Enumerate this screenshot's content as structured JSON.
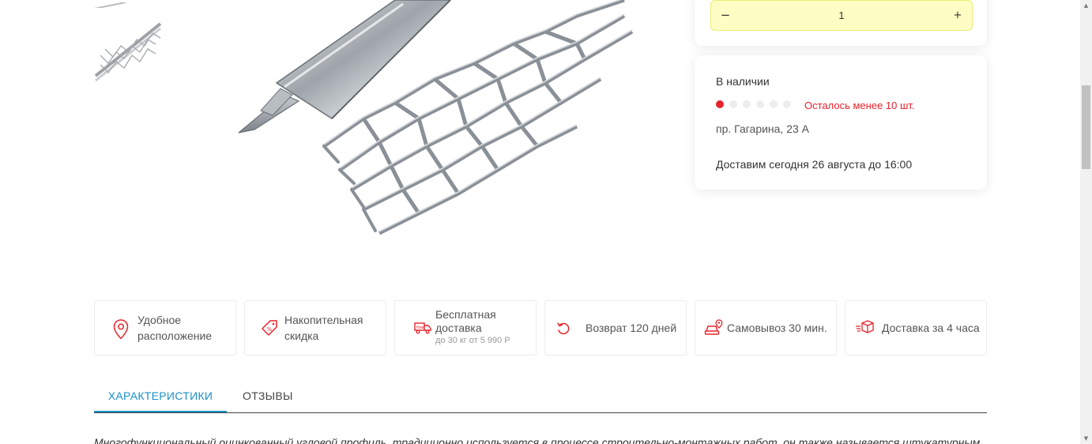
{
  "quantity": {
    "minus_label": "−",
    "value": "1",
    "plus_label": "+"
  },
  "stock": {
    "title": "В наличии",
    "level_filled": 1,
    "level_total": 6,
    "warning": "Осталось менее 10 шт.",
    "address": "пр. Гагарина, 23 А",
    "delivery": "Доставим сегодня 26 августа до 16:00",
    "accent_color": "#e8232d"
  },
  "features": [
    {
      "icon": "location-pin-icon",
      "line1": "Удобное",
      "line2": "расположение"
    },
    {
      "icon": "discount-tag-icon",
      "line1": "Накопительная",
      "line2": "скидка"
    },
    {
      "icon": "delivery-truck-icon",
      "line1": "Бесплатная",
      "line2": "доставка",
      "sub": "до 30 кг от 5 990 Р"
    },
    {
      "icon": "return-arrow-icon",
      "line1": "Возврат 120 дней"
    },
    {
      "icon": "car-pickup-icon",
      "line1": "Самовывоз 30 мин."
    },
    {
      "icon": "box-delivery-icon",
      "line1": "Доставка за 4 часа"
    }
  ],
  "icon_color": "#e8232d",
  "tabs": [
    {
      "label": "ХАРАКТЕРИСТИКИ",
      "active": true
    },
    {
      "label": "ОТЗЫВЫ",
      "active": false
    }
  ],
  "tab_active_color": "#1a90c9",
  "description": "Многофункциональный оцинкованный угловой профиль, традиционно используется в процессе строительно-монтажных работ, он также называется штукатурным"
}
